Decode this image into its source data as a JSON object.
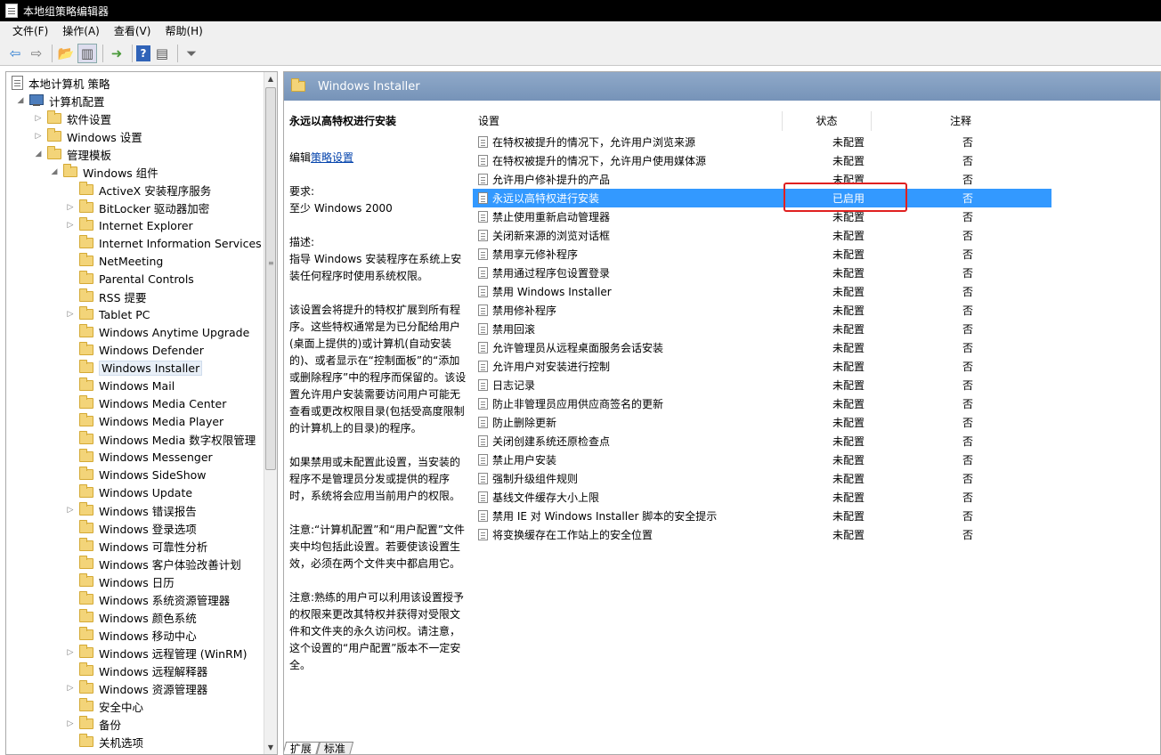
{
  "window": {
    "title": "本地组策略编辑器"
  },
  "menu": [
    "文件(F)",
    "操作(A)",
    "查看(V)",
    "帮助(H)"
  ],
  "toolbar": [
    "back-icon",
    "forward-icon",
    "up-icon",
    "show-hide-tree-icon",
    "export-icon",
    "help-icon",
    "properties-icon",
    "filter-icon"
  ],
  "tree": {
    "root": "本地计算机 策略",
    "computer_config": "计算机配置",
    "software_settings": "软件设置",
    "windows_settings": "Windows 设置",
    "admin_templates": "管理模板",
    "windows_components": "Windows 组件",
    "items": [
      {
        "label": "ActiveX 安装程序服务",
        "expand": false
      },
      {
        "label": "BitLocker 驱动器加密",
        "expand": true
      },
      {
        "label": "Internet Explorer",
        "expand": true
      },
      {
        "label": "Internet Information Services",
        "expand": false
      },
      {
        "label": "NetMeeting",
        "expand": false
      },
      {
        "label": "Parental Controls",
        "expand": false
      },
      {
        "label": "RSS 提要",
        "expand": false
      },
      {
        "label": "Tablet PC",
        "expand": true
      },
      {
        "label": "Windows Anytime Upgrade",
        "expand": false
      },
      {
        "label": "Windows Defender",
        "expand": false
      },
      {
        "label": "Windows Installer",
        "expand": false
      },
      {
        "label": "Windows Mail",
        "expand": false
      },
      {
        "label": "Windows Media Center",
        "expand": false
      },
      {
        "label": "Windows Media Player",
        "expand": false
      },
      {
        "label": "Windows Media 数字权限管理",
        "expand": false
      },
      {
        "label": "Windows Messenger",
        "expand": false
      },
      {
        "label": "Windows SideShow",
        "expand": false
      },
      {
        "label": "Windows Update",
        "expand": false
      },
      {
        "label": "Windows 错误报告",
        "expand": true
      },
      {
        "label": "Windows 登录选项",
        "expand": false
      },
      {
        "label": "Windows 可靠性分析",
        "expand": false
      },
      {
        "label": "Windows 客户体验改善计划",
        "expand": false
      },
      {
        "label": "Windows 日历",
        "expand": false
      },
      {
        "label": "Windows 系统资源管理器",
        "expand": false
      },
      {
        "label": "Windows 颜色系统",
        "expand": false
      },
      {
        "label": "Windows 移动中心",
        "expand": false
      },
      {
        "label": "Windows 远程管理 (WinRM)",
        "expand": true
      },
      {
        "label": "Windows 远程解释器",
        "expand": false
      },
      {
        "label": "Windows 资源管理器",
        "expand": true
      },
      {
        "label": "安全中心",
        "expand": false
      },
      {
        "label": "备份",
        "expand": true
      },
      {
        "label": "关机选项",
        "expand": false
      }
    ],
    "selected": "Windows Installer"
  },
  "panel": {
    "header": "Windows Installer",
    "desc_title": "永远以高特权进行安装",
    "edit_prefix": "编辑",
    "edit_link": "策略设置",
    "req_label": "要求:",
    "req_value": "至少 Windows 2000",
    "desc_label": "描述:",
    "paragraphs": [
      "指导 Windows 安装程序在系统上安装任何程序时使用系统权限。",
      "该设置会将提升的特权扩展到所有程序。这些特权通常是为已分配给用户(桌面上提供的)或计算机(自动安装的)、或者显示在“控制面板”的“添加或删除程序”中的程序而保留的。该设置允许用户安装需要访问用户可能无查看或更改权限目录(包括受高度限制的计算机上的目录)的程序。",
      "如果禁用或未配置此设置，当安装的程序不是管理员分发或提供的程序时，系统将会应用当前用户的权限。",
      "注意:“计算机配置”和“用户配置”文件夹中均包括此设置。若要使该设置生效，必须在两个文件夹中都启用它。",
      "注意:熟练的用户可以利用该设置授予的权限来更改其特权并获得对受限文件和文件夹的永久访问权。请注意，这个设置的“用户配置”版本不一定安全。"
    ],
    "tabs": [
      "扩展",
      "标准"
    ]
  },
  "list": {
    "columns": [
      "设置",
      "状态",
      "注释"
    ],
    "rows": [
      {
        "name": "在特权被提升的情况下，允许用户浏览来源",
        "state": "未配置",
        "note": "否"
      },
      {
        "name": "在特权被提升的情况下，允许用户使用媒体源",
        "state": "未配置",
        "note": "否"
      },
      {
        "name": "允许用户修补提升的产品",
        "state": "未配置",
        "note": "否"
      },
      {
        "name": "永远以高特权进行安装",
        "state": "已启用",
        "note": "否"
      },
      {
        "name": "禁止使用重新启动管理器",
        "state": "未配置",
        "note": "否"
      },
      {
        "name": "关闭新来源的浏览对话框",
        "state": "未配置",
        "note": "否"
      },
      {
        "name": "禁用享元修补程序",
        "state": "未配置",
        "note": "否"
      },
      {
        "name": "禁用通过程序包设置登录",
        "state": "未配置",
        "note": "否"
      },
      {
        "name": "禁用 Windows Installer",
        "state": "未配置",
        "note": "否"
      },
      {
        "name": "禁用修补程序",
        "state": "未配置",
        "note": "否"
      },
      {
        "name": "禁用回滚",
        "state": "未配置",
        "note": "否"
      },
      {
        "name": "允许管理员从远程桌面服务会话安装",
        "state": "未配置",
        "note": "否"
      },
      {
        "name": "允许用户对安装进行控制",
        "state": "未配置",
        "note": "否"
      },
      {
        "name": "日志记录",
        "state": "未配置",
        "note": "否"
      },
      {
        "name": "防止非管理员应用供应商签名的更新",
        "state": "未配置",
        "note": "否"
      },
      {
        "name": "防止删除更新",
        "state": "未配置",
        "note": "否"
      },
      {
        "name": "关闭创建系统还原检查点",
        "state": "未配置",
        "note": "否"
      },
      {
        "name": "禁止用户安装",
        "state": "未配置",
        "note": "否"
      },
      {
        "name": "强制升级组件规则",
        "state": "未配置",
        "note": "否"
      },
      {
        "name": "基线文件缓存大小上限",
        "state": "未配置",
        "note": "否"
      },
      {
        "name": "禁用 IE 对 Windows Installer 脚本的安全提示",
        "state": "未配置",
        "note": "否"
      },
      {
        "name": "将变换缓存在工作站上的安全位置",
        "state": "未配置",
        "note": "否"
      }
    ],
    "highlight_index": 3,
    "highlight_color": "#3399ff",
    "annotation_color": "#e02020"
  }
}
